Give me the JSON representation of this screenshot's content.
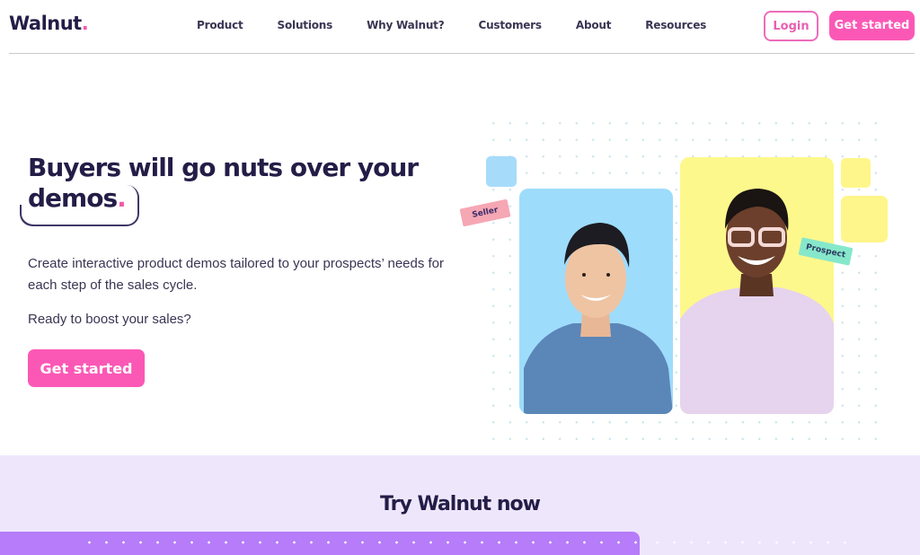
{
  "header": {
    "logo_text": "Walnut",
    "logo_dot": ".",
    "nav": [
      "Product",
      "Solutions",
      "Why Walnut?",
      "Customers",
      "About",
      "Resources"
    ],
    "login_label": "Login",
    "get_started_label": "Get started"
  },
  "hero": {
    "title_line1": "Buyers will go nuts over your",
    "title_line2": "demos",
    "title_dot": ".",
    "description": "Create interactive product demos tailored to your prospects’ needs for each step of the sales cycle.",
    "question": "Ready to boost your sales?",
    "cta_label": "Get started"
  },
  "illustration": {
    "seller_tag": "Seller",
    "prospect_tag": "Prospect",
    "colors": {
      "seller_bg": "#9edcfb",
      "prospect_bg": "#fdf88c",
      "seller_tag": "#f6a7b4",
      "prospect_tag": "#86e8cb"
    }
  },
  "try_section": {
    "title": "Try Walnut now"
  },
  "colors": {
    "brand_pink": "#fb58b6",
    "brand_navy": "#231d47",
    "lavender": "#eee7fc",
    "purple": "#b67cfa"
  }
}
